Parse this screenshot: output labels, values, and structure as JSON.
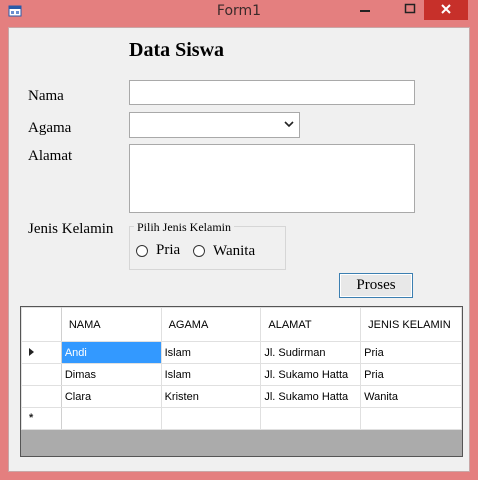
{
  "window": {
    "title": "Form1"
  },
  "form": {
    "heading": "Data Siswa",
    "labels": {
      "nama": "Nama",
      "agama": "Agama",
      "alamat": "Alamat",
      "jenis_kelamin": "Jenis Kelamin"
    },
    "inputs": {
      "nama_value": "",
      "agama_selected": "",
      "alamat_value": ""
    },
    "group": {
      "title": "Pilih Jenis Kelamin",
      "options": [
        {
          "label": "Pria",
          "checked": false
        },
        {
          "label": "Wanita",
          "checked": false
        }
      ]
    },
    "button_label": "Proses"
  },
  "grid": {
    "columns": [
      "NAMA",
      "AGAMA",
      "ALAMAT",
      "JENIS KELAMIN"
    ],
    "rows": [
      [
        "Andi",
        "Islam",
        "Jl. Sudirman",
        "Pria"
      ],
      [
        "Dimas",
        "Islam",
        "Jl. Sukamo Hatta",
        "Pria"
      ],
      [
        "Clara",
        "Kristen",
        "Jl. Sukamo Hatta",
        "Wanita"
      ],
      [
        "",
        "",
        "",
        ""
      ]
    ]
  },
  "colors": {
    "title_bar": "#e47f7f",
    "close_button": "#c7302a",
    "selection": "#3399ff",
    "client_bg": "#f0f0f0"
  },
  "icons": {
    "app": "form-icon",
    "minimize": "minimize-icon",
    "maximize": "maximize-icon",
    "close": "close-icon",
    "current_row": "current-row-arrow-icon",
    "new_row": "new-row-star-icon"
  }
}
